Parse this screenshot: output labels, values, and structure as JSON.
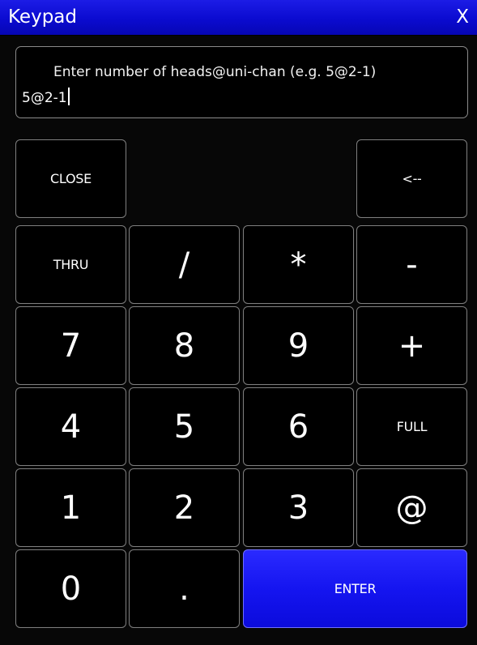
{
  "window": {
    "title": "Keypad",
    "close_label": "X"
  },
  "display": {
    "prompt": "Enter number of heads@uni-chan  (e.g. 5@2-1)",
    "value": "5@2-1"
  },
  "keys": {
    "close": "CLOSE",
    "backspace": "<--",
    "thru": "THRU",
    "slash": "/",
    "star": "*",
    "minus": "-",
    "k7": "7",
    "k8": "8",
    "k9": "9",
    "plus": "+",
    "k4": "4",
    "k5": "5",
    "k6": "6",
    "full": "FULL",
    "k1": "1",
    "k2": "2",
    "k3": "3",
    "at": "@",
    "k0": "0",
    "dot": ".",
    "enter": "ENTER"
  },
  "colors": {
    "title_bar": "#0b0bd0",
    "enter_key": "#1515f0",
    "key_bg": "#000000",
    "key_border": "#7f7f7f"
  }
}
